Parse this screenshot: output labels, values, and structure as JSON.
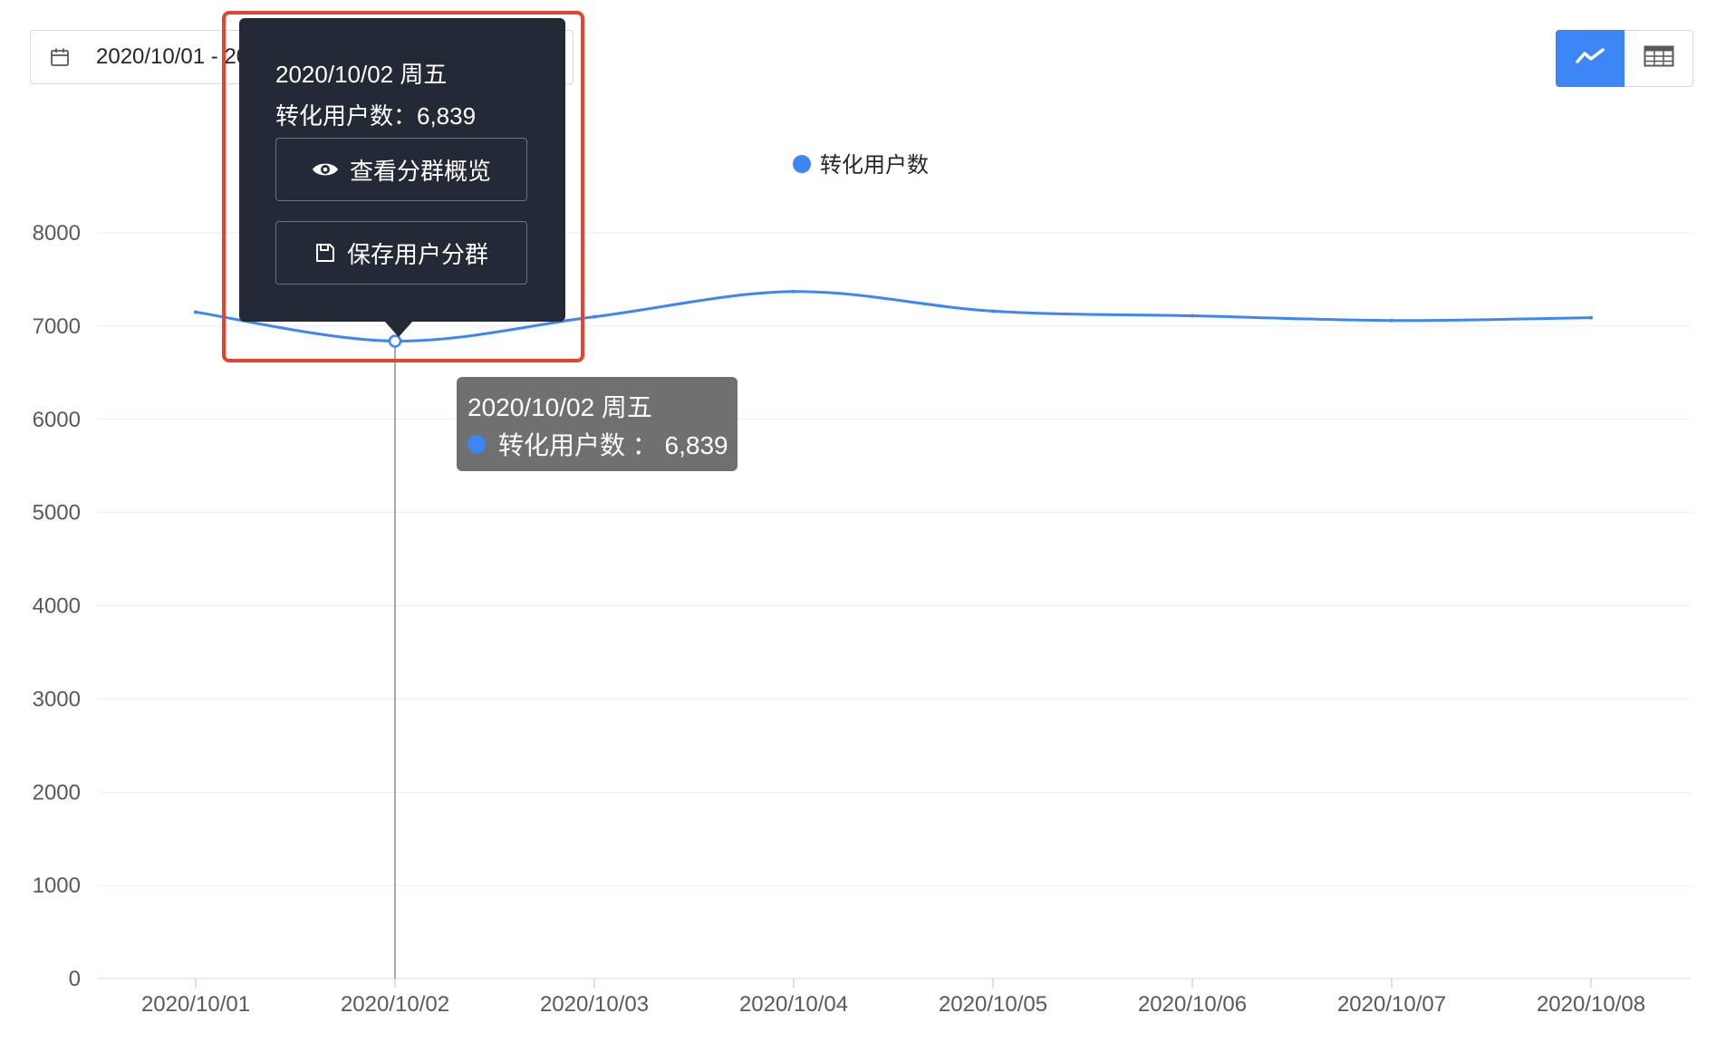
{
  "date_range": {
    "value": "2020/10/01 - 2020/10/08"
  },
  "view_toggle": {
    "line_icon": "line-chart-icon",
    "table_icon": "table-icon",
    "active": "line"
  },
  "popover": {
    "title": "2020/10/02 周五",
    "metric": "转化用户数：6,839",
    "view_button": "查看分群概览",
    "view_icon": "eye-icon",
    "save_button": "保存用户分群",
    "save_icon": "save-icon"
  },
  "tooltip": {
    "title": "2020/10/02 周五",
    "row": "转化用户数 ： 6,839"
  },
  "chart_data": {
    "type": "line",
    "x": [
      "2020/10/01",
      "2020/10/02",
      "2020/10/03",
      "2020/10/04",
      "2020/10/05",
      "2020/10/06",
      "2020/10/07",
      "2020/10/08"
    ],
    "series": [
      {
        "name": "转化用户数",
        "color": "#3d86f5",
        "values": [
          7150,
          6839,
          7100,
          7370,
          7160,
          7110,
          7060,
          7090
        ]
      }
    ],
    "yticks": [
      "0",
      "1000",
      "2000",
      "3000",
      "4000",
      "5000",
      "6000",
      "7000",
      "8000"
    ],
    "ylim": [
      0,
      8000
    ],
    "legend": "top-center",
    "grid": true,
    "highlight_index": 1
  },
  "colors": {
    "accent": "#3d86f5",
    "highlight_border": "#e8412c",
    "popover_bg": "#242a35"
  }
}
